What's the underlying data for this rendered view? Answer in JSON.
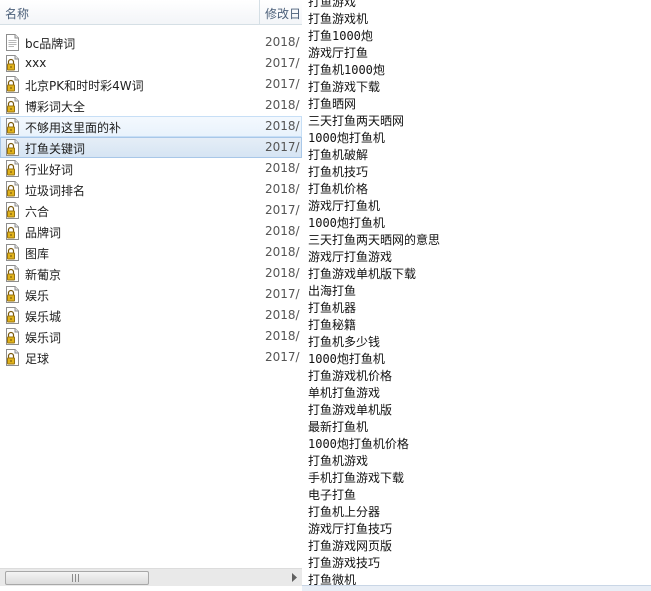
{
  "explorer": {
    "columns": {
      "name": "名称",
      "modified": "修改日"
    },
    "files": [
      {
        "name": "bc品牌词",
        "date": "2018/",
        "icon": "text-file-icon",
        "state": ""
      },
      {
        "name": "xxx",
        "date": "2017/",
        "icon": "locked-file-icon",
        "state": ""
      },
      {
        "name": "北京PK和时时彩4W词",
        "date": "2017/",
        "icon": "locked-file-icon",
        "state": ""
      },
      {
        "name": "博彩词大全",
        "date": "2018/",
        "icon": "locked-file-icon",
        "state": ""
      },
      {
        "name": "不够用这里面的补",
        "date": "2018/",
        "icon": "locked-file-icon",
        "state": "hover"
      },
      {
        "name": "打鱼关键词",
        "date": "2017/",
        "icon": "locked-file-icon",
        "state": "selected"
      },
      {
        "name": "行业好词",
        "date": "2018/",
        "icon": "locked-file-icon",
        "state": ""
      },
      {
        "name": "垃圾词排名",
        "date": "2018/",
        "icon": "locked-file-icon",
        "state": ""
      },
      {
        "name": "六合",
        "date": "2017/",
        "icon": "locked-file-icon",
        "state": ""
      },
      {
        "name": "品牌词",
        "date": "2018/",
        "icon": "locked-file-icon",
        "state": ""
      },
      {
        "name": "图库",
        "date": "2018/",
        "icon": "locked-file-icon",
        "state": ""
      },
      {
        "name": "新葡京",
        "date": "2018/",
        "icon": "locked-file-icon",
        "state": ""
      },
      {
        "name": "娱乐",
        "date": "2017/",
        "icon": "locked-file-icon",
        "state": ""
      },
      {
        "name": "娱乐城",
        "date": "2018/",
        "icon": "locked-file-icon",
        "state": ""
      },
      {
        "name": "娱乐词",
        "date": "2018/",
        "icon": "locked-file-icon",
        "state": ""
      },
      {
        "name": "足球",
        "date": "2017/",
        "icon": "locked-file-icon",
        "state": ""
      }
    ]
  },
  "keywords": [
    "打鱼游戏",
    "打鱼游戏机",
    "打鱼1000炮",
    "游戏厅打鱼",
    "打鱼机1000炮",
    "打鱼游戏下载",
    "打鱼晒网",
    "三天打鱼两天晒网",
    "1000炮打鱼机",
    "打鱼机破解",
    "打鱼机技巧",
    "打鱼机价格",
    "游戏厅打鱼机",
    "1000炮打鱼机",
    "三天打鱼两天晒网的意思",
    "游戏厅打鱼游戏",
    "打鱼游戏单机版下载",
    "出海打鱼",
    "打鱼机器",
    "打鱼秘籍",
    "打鱼机多少钱",
    "1000炮打鱼机",
    "打鱼游戏机价格",
    "单机打鱼游戏",
    "打鱼游戏单机版",
    "最新打鱼机",
    "1000炮打鱼机价格",
    "打鱼机游戏",
    "手机打鱼游戏下载",
    "电子打鱼",
    "打鱼机上分器",
    "游戏厅打鱼技巧",
    "打鱼游戏网页版",
    "打鱼游戏技巧",
    "打鱼微机"
  ],
  "icons": {
    "sort": "sort-ascending-icon",
    "scroll_left": "scroll-left-arrow-icon",
    "scroll_right": "scroll-right-arrow-icon"
  }
}
